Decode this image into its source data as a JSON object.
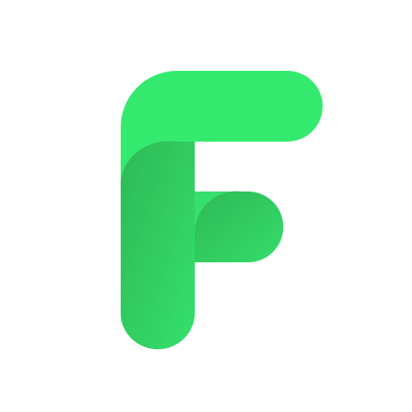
{
  "logo": {
    "icon": "letter-f-logo-icon",
    "letter": "F"
  },
  "colors": {
    "background": "#ffffff",
    "primary_green": "#34ea6e",
    "shadow_green_dark": "#2fb956",
    "shadow_green_light": "#34e06b"
  }
}
